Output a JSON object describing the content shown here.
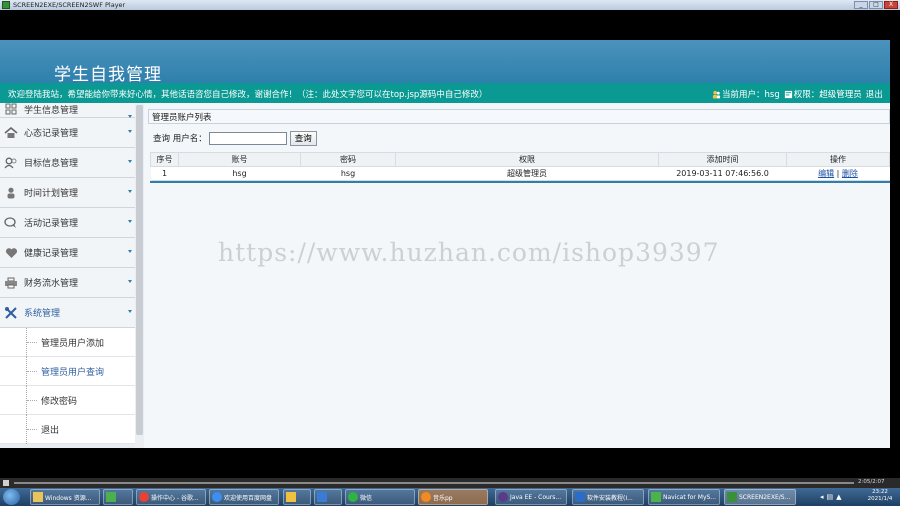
{
  "player": {
    "title": "SCREEN2EXE/SCREEN2SWF Player",
    "time": "2:05/2:07",
    "buttons": [
      "_",
      "□",
      "X"
    ]
  },
  "app": {
    "title": "学生自我管理",
    "welcome": "欢迎登陆我站，希望能给你带来好心情，其他话语咨您自己修改，谢谢合作！（注：此处文字您可以在top.jsp源码中自己修改）",
    "current_user_label": "当前用户：hsg",
    "role_label": "权限：超级管理员",
    "logout_label": "退出"
  },
  "sidebar": {
    "items": [
      {
        "label": "学生信息管理",
        "icon": "grid-icon"
      },
      {
        "label": "心态记录管理",
        "icon": "home-icon"
      },
      {
        "label": "目标信息管理",
        "icon": "users-icon"
      },
      {
        "label": "时间计划管理",
        "icon": "person-icon"
      },
      {
        "label": "活动记录管理",
        "icon": "chat-icon"
      },
      {
        "label": "健康记录管理",
        "icon": "heart-icon"
      },
      {
        "label": "财务流水管理",
        "icon": "printer-icon"
      },
      {
        "label": "系统管理",
        "icon": "tools-icon"
      }
    ],
    "sub_items": [
      {
        "label": "管理员用户添加"
      },
      {
        "label": "管理员用户查询"
      },
      {
        "label": "修改密码"
      },
      {
        "label": "退出"
      }
    ]
  },
  "main": {
    "panel_title": "管理员账户列表",
    "search_label": "查询 用户名：",
    "search_value": "",
    "search_button": "查询",
    "columns": [
      "序号",
      "账号",
      "密码",
      "权限",
      "添加时间",
      "操作"
    ],
    "rows": [
      {
        "no": "1",
        "account": "hsg",
        "password": "hsg",
        "role": "超级管理员",
        "time": "2019-03-11 07:46:56.0",
        "edit": "编辑",
        "sep": "|",
        "del": "删除"
      }
    ]
  },
  "watermark": "https://www.huzhan.com/ishop39397",
  "taskbar": {
    "items": [
      "Windows 资源...",
      "",
      "操作中心 - 谷歌...",
      "欢迎使用百度网盘",
      "",
      "",
      "微信",
      "音乐pp",
      "Java EE - Cours...",
      "软件安装教程(I...",
      "Navicat for MyS...",
      "SCREEN2EXE/S..."
    ],
    "clock_time": "23:22",
    "clock_date": "2021/1/4"
  }
}
